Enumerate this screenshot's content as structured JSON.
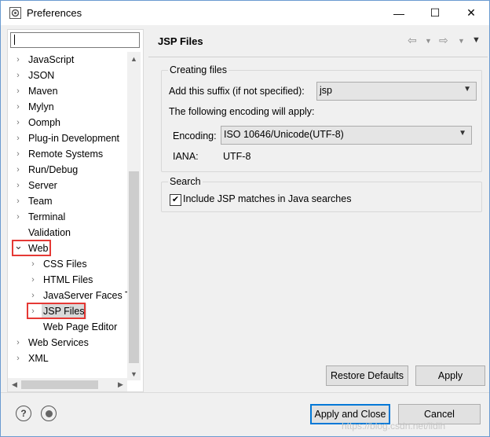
{
  "window": {
    "title": "Preferences"
  },
  "titlebar": {
    "minimize": "—",
    "maximize": "☐",
    "close": "✕"
  },
  "left": {
    "filter_value": "",
    "items": [
      {
        "label": "JavaScript",
        "expander": "›"
      },
      {
        "label": "JSON",
        "expander": "›"
      },
      {
        "label": "Maven",
        "expander": "›"
      },
      {
        "label": "Mylyn",
        "expander": "›"
      },
      {
        "label": "Oomph",
        "expander": "›"
      },
      {
        "label": "Plug-in Development",
        "expander": "›"
      },
      {
        "label": "Remote Systems",
        "expander": "›"
      },
      {
        "label": "Run/Debug",
        "expander": "›"
      },
      {
        "label": "Server",
        "expander": "›"
      },
      {
        "label": "Team",
        "expander": "›"
      },
      {
        "label": "Terminal",
        "expander": "›"
      },
      {
        "label": "Validation",
        "expander": ""
      },
      {
        "label": "Web",
        "expander": "⌄"
      },
      {
        "label": "CSS Files",
        "expander": "›"
      },
      {
        "label": "HTML Files",
        "expander": "›"
      },
      {
        "label": "JavaServer Faces T",
        "expander": "›"
      },
      {
        "label": "JSP Files",
        "expander": "›"
      },
      {
        "label": "Web Page Editor",
        "expander": ""
      },
      {
        "label": "Web Services",
        "expander": "›"
      },
      {
        "label": "XML",
        "expander": "›"
      }
    ]
  },
  "right": {
    "title": "JSP Files",
    "creating_files": {
      "legend": "Creating files",
      "suffix_label": "Add this suffix (if not specified):",
      "suffix_value": "jsp",
      "encoding_note": "The following encoding will apply:",
      "encoding_label": "Encoding:",
      "encoding_value": "ISO 10646/Unicode(UTF-8)",
      "iana_label": "IANA:",
      "iana_value": "UTF-8"
    },
    "search": {
      "legend": "Search",
      "include_label": "Include JSP matches in Java searches",
      "include_checked": true
    },
    "restore_defaults": "Restore Defaults",
    "apply": "Apply"
  },
  "footer": {
    "apply_and_close": "Apply and Close",
    "cancel": "Cancel",
    "help_icon": "?",
    "watermark": "https://blog.csdn.net/lidih"
  },
  "colors": {
    "highlight_box": "#e53935",
    "accent": "#0078d7"
  }
}
